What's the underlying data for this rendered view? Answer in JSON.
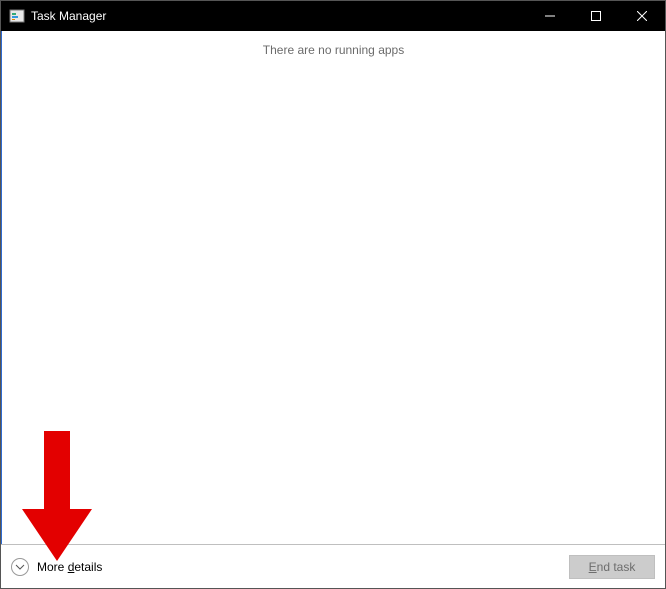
{
  "titlebar": {
    "title": "Task Manager"
  },
  "content": {
    "empty_message": "There are no running apps"
  },
  "footer": {
    "more_details_label_pre": "More ",
    "more_details_label_ul": "d",
    "more_details_label_post": "etails",
    "end_task_label_ul": "E",
    "end_task_label_post": "nd task"
  }
}
